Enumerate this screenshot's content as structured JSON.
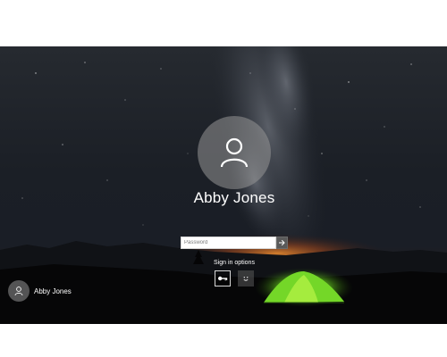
{
  "lock_screen": {
    "user_name": "Abby Jones",
    "password_placeholder": "Password",
    "submit_icon": "arrow-right-icon",
    "sign_in_options_label": "Sign in options",
    "sign_in_options": [
      {
        "icon": "key-icon",
        "selected": true
      },
      {
        "icon": "face-icon",
        "selected": false
      }
    ],
    "other_users": [
      {
        "name": "Abby Jones",
        "icon": "user-icon"
      }
    ],
    "background": {
      "subject": "night sky with milky way and glowing green tent",
      "accent_tent_color": "#7de033",
      "horizon_glow_color": "#e06a1e",
      "sky_color": "#1a1e26"
    }
  }
}
